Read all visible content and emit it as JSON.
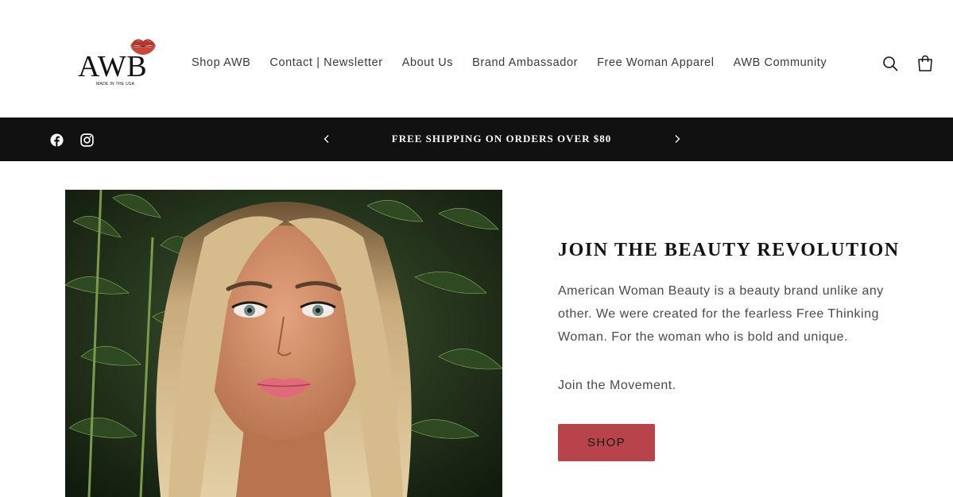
{
  "header": {
    "logo_text": "AWB",
    "logo_subtext": "MADE IN THE USA",
    "nav": [
      "Shop AWB",
      "Contact | Newsletter",
      "About Us",
      "Brand Ambassador",
      "Free Woman Apparel",
      "AWB Community"
    ],
    "icons": {
      "search": "search-icon",
      "cart": "cart-icon"
    }
  },
  "announcement": {
    "text": "FREE SHIPPING ON ORDERS OVER $80",
    "social_icons": [
      "facebook-icon",
      "instagram-icon"
    ]
  },
  "hero": {
    "title": "JOIN THE BEAUTY REVOLUTION",
    "body": "American Woman Beauty is a beauty brand unlike any other. We were created for the fearless Free Thinking Woman. For the woman who is bold and unique.",
    "subtext": "Join the Movement.",
    "button_label": "SHOP"
  },
  "colors": {
    "announcement_bg": "#111111",
    "button_bg": "#b9434a",
    "text": "#121212",
    "body_text": "#4a4a4a",
    "logo_lips": "#b5352f"
  }
}
